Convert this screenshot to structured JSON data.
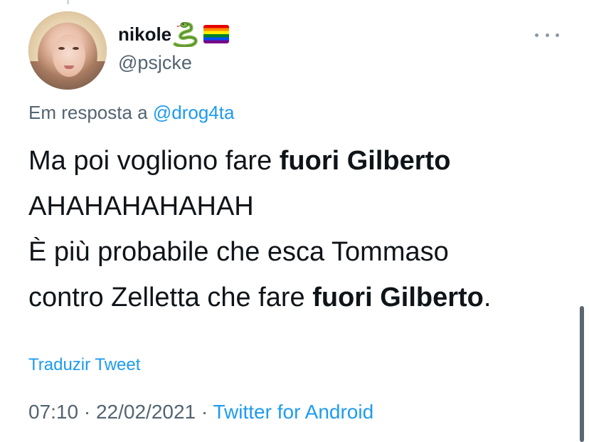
{
  "user": {
    "display_name": "nikole",
    "emoji": [
      "snake-icon",
      "rainbow-flag-icon"
    ],
    "handle": "@psjcke"
  },
  "reply": {
    "prefix": "Em resposta a",
    "mention": "@drog4ta"
  },
  "tweet": {
    "line1_a": "Ma poi vogliono fare ",
    "line1_b": "fuori Gilberto",
    "line2": "AHAHAHAHAHAH",
    "line3": "È più probabile che esca Tommaso",
    "line4_a": "contro Zelletta che fare ",
    "line4_b": "fuori Gilberto",
    "line4_c": "."
  },
  "translate_label": "Traduzir Tweet",
  "meta": {
    "time": "07:10",
    "sep1": " · ",
    "date": "22/02/2021",
    "sep2": " · ",
    "source": "Twitter for Android"
  },
  "colors": {
    "link": "#1d9bf0",
    "secondary_text": "#536471",
    "primary_text": "#0f1419"
  }
}
